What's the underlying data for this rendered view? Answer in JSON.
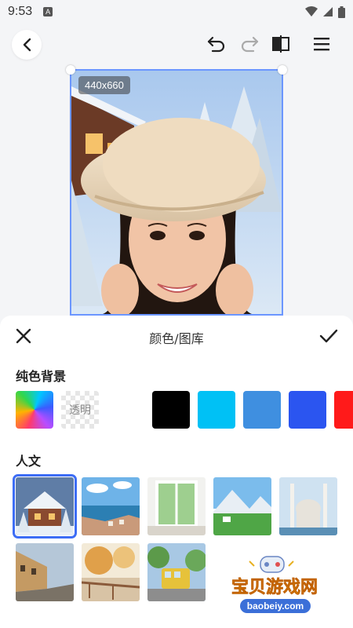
{
  "status_bar": {
    "time": "9:53",
    "badge": "A"
  },
  "toolbar": {
    "back": "back-icon",
    "undo": "undo-icon",
    "redo": "redo-icon",
    "compare": "compare-icon",
    "menu": "menu-icon"
  },
  "canvas": {
    "size_label": "440x660"
  },
  "sheet": {
    "title": "颜色/图库",
    "solid_section": "纯色背景",
    "transparent_label": "透明",
    "colors": [
      "#ffffff",
      "#000000",
      "#00c1f5",
      "#3f8fe0",
      "#2b55f0",
      "#ff1a1a"
    ],
    "humanities_section": "人文"
  },
  "watermark": {
    "title": "宝贝游戏网",
    "url": "baobeiy.com"
  },
  "accent": "#3d6df5"
}
